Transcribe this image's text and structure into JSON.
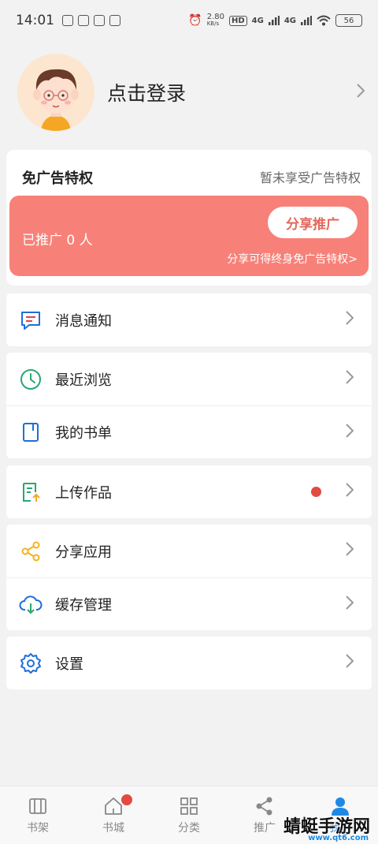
{
  "status_bar": {
    "time": "14:01",
    "speed": "2.80",
    "speed_unit": "KB/s",
    "hd": "HD",
    "net1": "4G",
    "net2": "4G",
    "battery": "56"
  },
  "profile": {
    "login_label": "点击登录"
  },
  "ad_privilege": {
    "title": "免广告特权",
    "status": "暂未享受广告特权",
    "promoted": "已推广 0 人",
    "share_button": "分享推广",
    "share_hint": "分享可得终身免广告特权>"
  },
  "menu": {
    "messages": "消息通知",
    "recent": "最近浏览",
    "my_booklist": "我的书单",
    "upload": "上传作品",
    "share_app": "分享应用",
    "cache": "缓存管理",
    "settings": "设置"
  },
  "tabs": [
    {
      "label": "书架"
    },
    {
      "label": "书城"
    },
    {
      "label": "分类"
    },
    {
      "label": "推广"
    },
    {
      "label": "我的"
    }
  ],
  "watermark": {
    "text": "蜻蜓手游网",
    "url": "www.qt6.com"
  },
  "colors": {
    "accent": "#1e88e5",
    "promo_red": "#f78178",
    "badge": "#e24a42"
  }
}
